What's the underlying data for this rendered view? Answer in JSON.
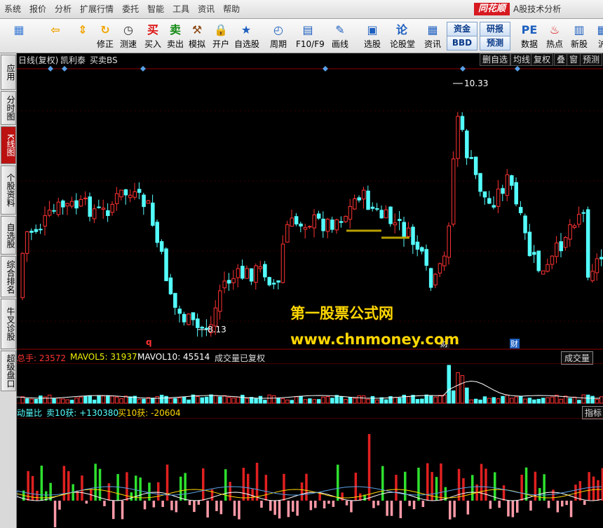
{
  "menu": {
    "items": [
      "系统",
      "报价",
      "分析",
      "扩展行情",
      "委托",
      "智能",
      "工具",
      "资讯",
      "帮助"
    ],
    "logo": "同花顺",
    "window_title": "A股技术分析"
  },
  "toolbar": {
    "buttons": [
      {
        "label": "",
        "icon": "grid-icon"
      },
      {
        "label": "",
        "icon": "back-arrow-icon"
      },
      {
        "label": "",
        "icon": "up-down-arrows-icon"
      },
      {
        "label": "修正",
        "icon": "refresh-icon"
      },
      {
        "label": "测速",
        "icon": "clock-icon"
      },
      {
        "label": "买入",
        "icon": "buy-icon",
        "glyph": "买"
      },
      {
        "label": "卖出",
        "icon": "sell-icon",
        "glyph": "卖"
      },
      {
        "label": "模拟",
        "icon": "hammer-icon"
      },
      {
        "label": "开户",
        "icon": "lock-icon"
      },
      {
        "label": "自选股",
        "icon": "star-folder-icon"
      },
      {
        "label": "周期",
        "icon": "clock-period-icon"
      },
      {
        "label": "F10/F9",
        "icon": "f10-icon"
      },
      {
        "label": "画线",
        "icon": "pen-icon"
      },
      {
        "label": "选股",
        "icon": "select-stock-icon"
      },
      {
        "label": "论股堂",
        "icon": "forum-icon",
        "glyph": "论"
      },
      {
        "label": "资讯",
        "icon": "news-icon"
      },
      {
        "label": "数据",
        "icon": "data-icon",
        "glyph": "PE"
      },
      {
        "label": "热点",
        "icon": "hot-icon"
      },
      {
        "label": "新股",
        "icon": "ipo-icon"
      },
      {
        "label": "沪",
        "icon": "sh-icon"
      }
    ],
    "box_buttons": {
      "fund": "资金",
      "bbd": "BBD",
      "research": "研报",
      "forecast": "预测"
    }
  },
  "left_tabs": [
    {
      "label": "应用",
      "active": false
    },
    {
      "label": "分时图",
      "active": false
    },
    {
      "label": "K线图",
      "active": true
    },
    {
      "label": "个股资料",
      "active": false
    },
    {
      "label": "自选股",
      "active": false
    },
    {
      "label": "综合排名",
      "active": false
    },
    {
      "label": "牛叉诊股",
      "active": false
    },
    {
      "label": "超级盘口",
      "active": false
    }
  ],
  "chart_header": {
    "period": "日线(复权)",
    "stock": "凯利泰",
    "indicator": "买卖BS"
  },
  "chart_buttons": [
    "删自选",
    "均线",
    "复权",
    "叠",
    "窗",
    "预测"
  ],
  "price_labels": {
    "high": "10.33",
    "low": "8.13"
  },
  "markers": {
    "q": "q",
    "fin1": "财",
    "fin2": "财"
  },
  "volume_header": {
    "total": "总手: 23572",
    "mavol5": "MAVOL5: 31937",
    "mavol10": "MAVOL10: 45514",
    "note": "成交量已复权",
    "right": "成交量"
  },
  "indicator_header": {
    "name": "动量比",
    "sell": "卖10获: +130380",
    "buy": "买10获: -20604",
    "right": "指标"
  },
  "watermark": {
    "line1": "第一股票公式网",
    "line2": "www.chnmoney.com"
  },
  "colors": {
    "up": "#ff3232",
    "down": "#54ffff",
    "bg": "#000000",
    "grid": "#8b0000",
    "accent": "#d71920"
  }
}
